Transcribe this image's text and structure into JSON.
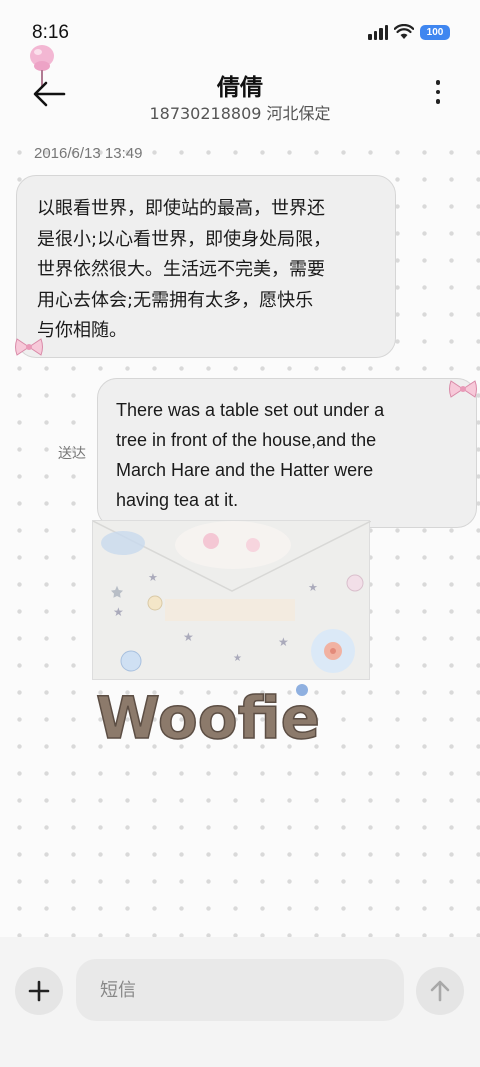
{
  "status_bar": {
    "time": "8:16",
    "battery": "100",
    "icons": [
      "signal-icon",
      "wifi-icon",
      "battery-icon"
    ]
  },
  "header": {
    "contact_name": "倩倩",
    "contact_sub": "18730218809 河北保定",
    "back_icon": "arrow-left-icon",
    "more_icon": "more-vertical-icon"
  },
  "conversation": {
    "timestamp": "2016/6/13 13:49",
    "messages": [
      {
        "direction": "incoming",
        "lines": [
          "以眼看世界，即使站的最高，世界还",
          "是很小;以心看世界，即使身处局限，",
          "世界依然很大。生活远不完美，需要",
          "用心去体会;无需拥有太多，愿快乐",
          "与你相随。"
        ]
      },
      {
        "direction": "outgoing",
        "lines": [
          "There was a table set out under a",
          "tree in front of the house,and the",
          "March Hare and the Hatter were",
          "having tea at it."
        ],
        "status": "送达"
      }
    ],
    "sticker_text": "Woofie"
  },
  "input_bar": {
    "placeholder": "短信",
    "add_icon": "plus-icon",
    "send_icon": "arrow-up-icon"
  },
  "colors": {
    "accent_battery": "#3f86f0",
    "bubble_bg": "#efefef",
    "background": "#fbfbfb"
  }
}
